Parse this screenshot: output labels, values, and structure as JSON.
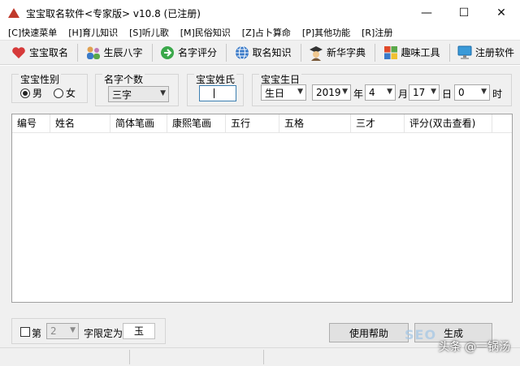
{
  "window": {
    "title": "宝宝取名软件<专家版> v10.8 (已注册)",
    "controls": {
      "minimize": "—",
      "maximize": "☐",
      "close": "✕"
    }
  },
  "menu": [
    "[C]快速菜单",
    "[H]育儿知识",
    "[S]听儿歌",
    "[M]民俗知识",
    "[Z]占卜算命",
    "[P]其他功能",
    "[R]注册"
  ],
  "toolbar": [
    {
      "label": "宝宝取名",
      "icon": "heart-icon",
      "color": "#d63a3a"
    },
    {
      "label": "生辰八字",
      "icon": "people-icon",
      "color": "#d99a3a"
    },
    {
      "label": "名字评分",
      "icon": "arrow-right-icon",
      "color": "#3aa84a"
    },
    {
      "label": "取名知识",
      "icon": "globe-icon",
      "color": "#3a7ac8"
    },
    {
      "label": "新华字典",
      "icon": "scholar-icon",
      "color": "#7a5a3a"
    },
    {
      "label": "趣味工具",
      "icon": "windows-icon",
      "color": "#e04a2a"
    },
    {
      "label": "注册软件",
      "icon": "monitor-icon",
      "color": "#3a9ad8"
    }
  ],
  "gender": {
    "label": "宝宝性别",
    "male": "男",
    "female": "女",
    "selected": "male"
  },
  "name_count": {
    "label": "名字个数",
    "value": "三字"
  },
  "surname": {
    "label": "宝宝姓氏",
    "value": ""
  },
  "birth": {
    "label": "宝宝生日",
    "calendar": "生日",
    "year": "2019",
    "year_unit": "年",
    "month": "4",
    "month_unit": "月",
    "day": "17",
    "day_unit": "日",
    "hour": "0",
    "hour_unit": "时"
  },
  "table": {
    "columns": [
      "编号",
      "姓名",
      "简体笔画",
      "康熙笔画",
      "五行",
      "五格",
      "三才",
      "评分(双击查看)"
    ]
  },
  "bottom": {
    "di_label": "第",
    "position_value": "2",
    "limit_label": "字限定为",
    "limit_value": "玉",
    "help_button": "使用帮助",
    "generate_button": "生成"
  },
  "watermark": "头条 @一锅汤",
  "seo_mark": "SEO"
}
